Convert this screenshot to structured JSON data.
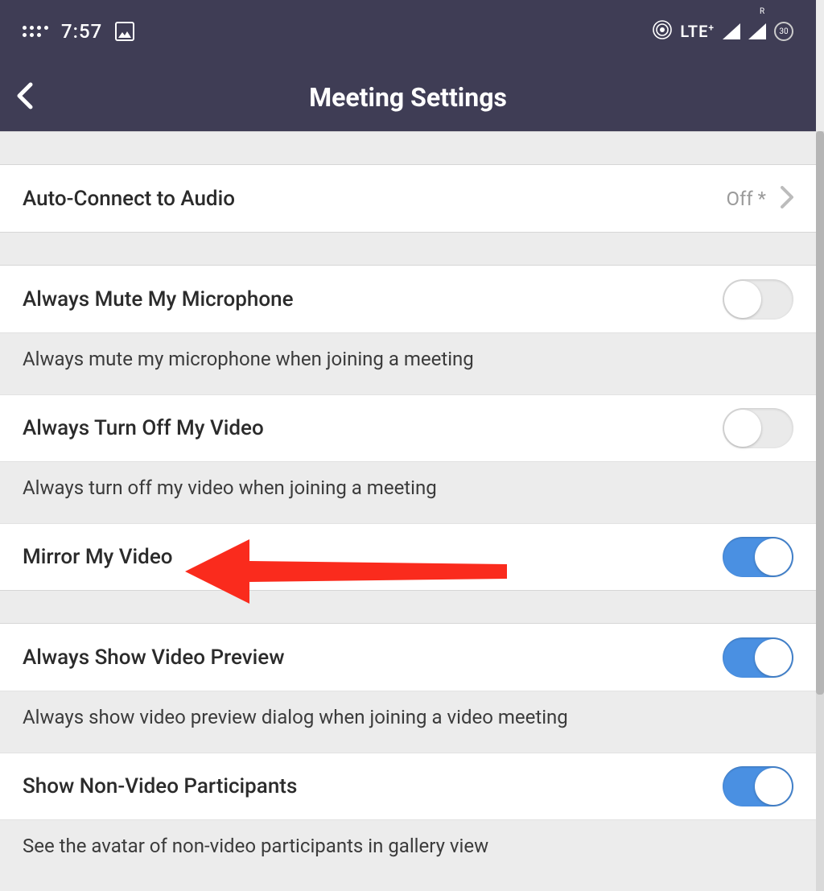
{
  "statusbar": {
    "time": "7:57",
    "network_label": "LTE",
    "network_plus": "+",
    "roaming_indicator": "R",
    "battery_value": "30"
  },
  "header": {
    "title": "Meeting Settings"
  },
  "rows": {
    "auto_connect": {
      "label": "Auto-Connect to Audio",
      "value": "Off *"
    },
    "mute_mic": {
      "label": "Always Mute My Microphone",
      "desc": "Always mute my microphone when joining a meeting"
    },
    "off_video": {
      "label": "Always Turn Off My Video",
      "desc": "Always turn off my video when joining a meeting"
    },
    "mirror": {
      "label": "Mirror My Video"
    },
    "preview": {
      "label": "Always Show Video Preview",
      "desc": "Always show video preview dialog when joining a video meeting"
    },
    "nonvideo": {
      "label": "Show Non-Video Participants",
      "desc": "See the avatar of non-video participants in gallery view"
    }
  }
}
